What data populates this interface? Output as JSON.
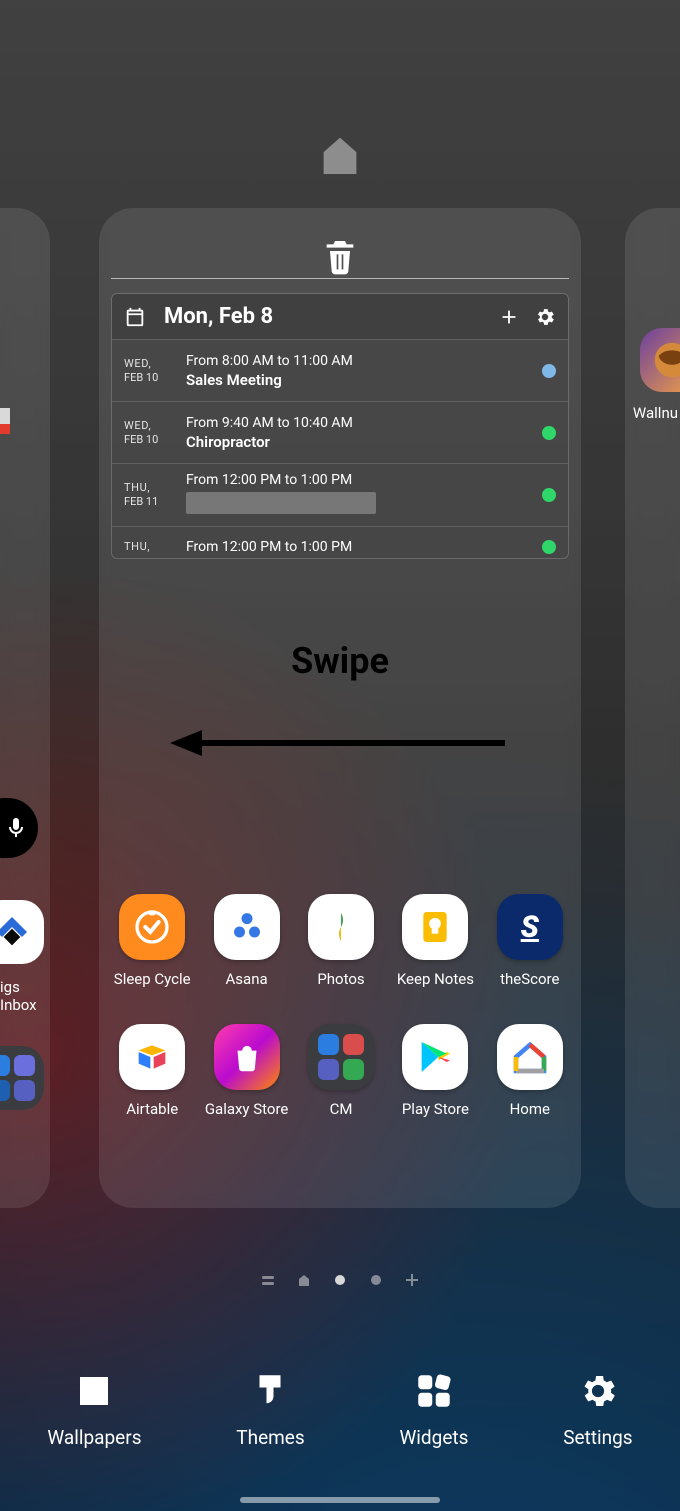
{
  "annotation": {
    "swipe_label": "Swipe"
  },
  "calendar": {
    "date_title": "Mon, Feb 8",
    "events": [
      {
        "dow": "WED,",
        "md": "FEB 10",
        "time": "From 8:00 AM to 11:00 AM",
        "title": "Sales Meeting",
        "color": "#7fb8e6"
      },
      {
        "dow": "WED,",
        "md": "FEB 10",
        "time": "From 9:40 AM to 10:40 AM",
        "title": "Chiropractor",
        "color": "#2fd66a"
      },
      {
        "dow": "THU,",
        "md": "FEB 11",
        "time": "From 12:00 PM to 1:00 PM",
        "title": "",
        "color": "#2fd66a",
        "redacted": true
      },
      {
        "dow": "THU,",
        "md": "",
        "time": "From 12:00 PM to 1:00 PM",
        "title": "",
        "color": "#2fd66a"
      }
    ]
  },
  "apps_main": {
    "row1": [
      {
        "name": "Sleep Cycle"
      },
      {
        "name": "Asana"
      },
      {
        "name": "Photos"
      },
      {
        "name": "Keep Notes"
      },
      {
        "name": "theScore"
      }
    ],
    "row2": [
      {
        "name": "Airtable"
      },
      {
        "name": "Galaxy Store"
      },
      {
        "name": "CM"
      },
      {
        "name": "Play Store"
      },
      {
        "name": "Home"
      }
    ]
  },
  "page_left": {
    "partial_label": "igs Inbox"
  },
  "page_right": {
    "partial_label": "Wallnu"
  },
  "bottom_bar": {
    "wallpapers": "Wallpapers",
    "themes": "Themes",
    "widgets": "Widgets",
    "settings": "Settings"
  }
}
